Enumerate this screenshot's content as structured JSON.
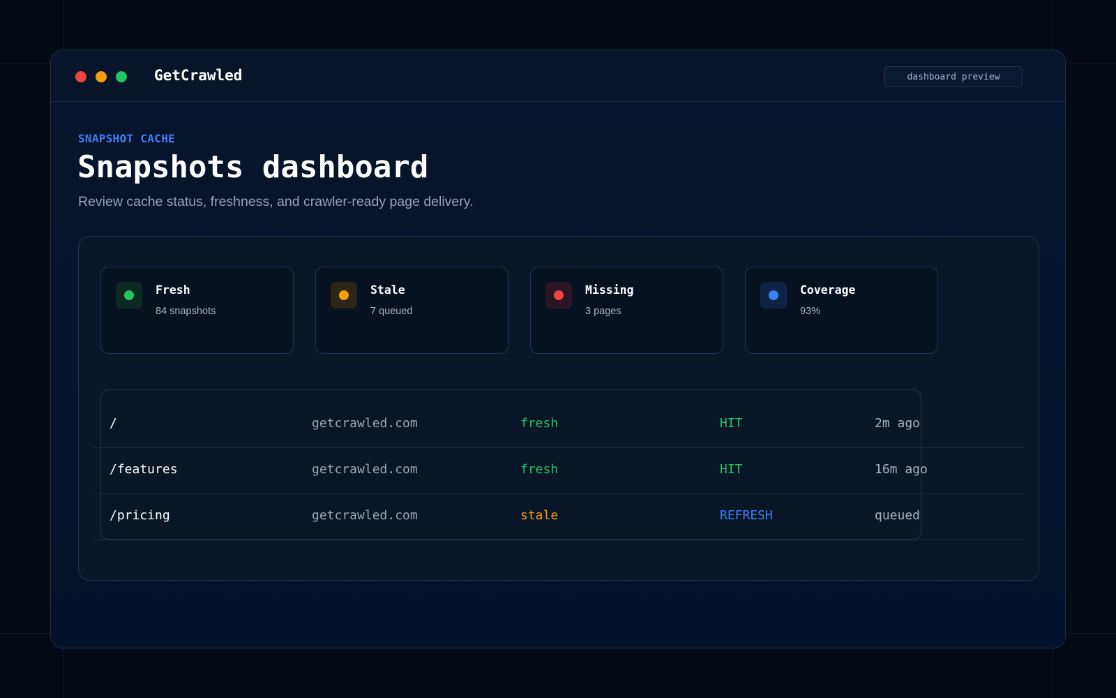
{
  "app": {
    "title": "GetCrawled",
    "badge": "dashboard preview",
    "window_controls": [
      "close-dot",
      "minimize-dot",
      "maximize-dot"
    ]
  },
  "header": {
    "eyebrow": "SNAPSHOT CACHE",
    "title": "Snapshots dashboard",
    "subtitle": "Review cache status, freshness, and crawler-ready page delivery."
  },
  "colors": {
    "accent": "#3b82f6",
    "fresh": "#22c55e",
    "stale": "#f59e0b",
    "missing": "#ef4444",
    "coverage": "#3b82f6"
  },
  "stats": [
    {
      "label": "Fresh",
      "value": "84 snapshots",
      "color": "#22c55e",
      "bg": "#0d2a22",
      "icon": "status-dot-icon"
    },
    {
      "label": "Stale",
      "value": "7 queued",
      "color": "#f59e0b",
      "bg": "#2b2618",
      "icon": "status-dot-icon"
    },
    {
      "label": "Missing",
      "value": "3 pages",
      "color": "#ef4444",
      "bg": "#2a1623",
      "icon": "status-dot-icon"
    },
    {
      "label": "Coverage",
      "value": "93%",
      "color": "#3b82f6",
      "bg": "#0f2444",
      "icon": "status-dot-icon"
    }
  ],
  "table": {
    "rows": [
      {
        "path": "/",
        "host": "getcrawled.com",
        "freshness": "fresh",
        "freshness_color": "#22c55e",
        "cache": "HIT",
        "cache_color": "#22c55e",
        "updated": "2m ago"
      },
      {
        "path": "/features",
        "host": "getcrawled.com",
        "freshness": "fresh",
        "freshness_color": "#22c55e",
        "cache": "HIT",
        "cache_color": "#22c55e",
        "updated": "16m ago"
      },
      {
        "path": "/pricing",
        "host": "getcrawled.com",
        "freshness": "stale",
        "freshness_color": "#f59e0b",
        "cache": "REFRESH",
        "cache_color": "#3b82f6",
        "updated": "queued"
      }
    ]
  }
}
